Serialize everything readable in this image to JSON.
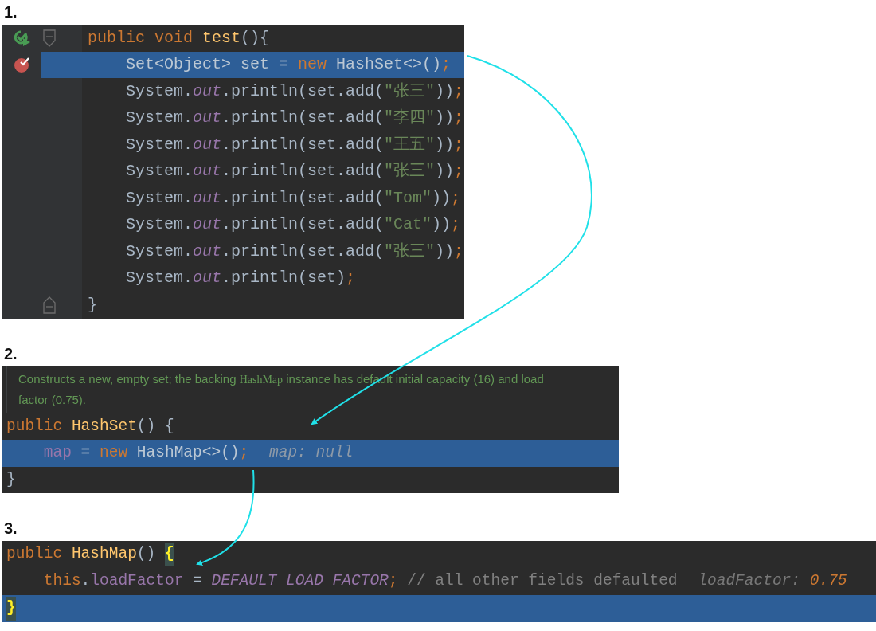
{
  "sections": [
    {
      "label": "1.",
      "kind": "editor",
      "lines": [
        {
          "selected": false,
          "run_marker": true,
          "fold_start": true,
          "tokens": [
            {
              "kind": "keyword",
              "text": "public void "
            },
            {
              "kind": "method",
              "text": "test"
            },
            {
              "kind": "plain",
              "text": "(){"
            }
          ],
          "children": [
            {
              "selected": true,
              "breakpoint": true,
              "tokens": [
                {
                  "kind": "plain",
                  "text": "Set<Object> set = "
                },
                {
                  "kind": "keyword",
                  "text": "new "
                },
                {
                  "kind": "plain",
                  "text": "HashSet<>()"
                },
                {
                  "kind": "keyword",
                  "text": ";"
                }
              ]
            },
            {
              "selected": false,
              "tokens": [
                {
                  "kind": "plain",
                  "text": "System."
                },
                {
                  "kind": "static_field",
                  "text": "out"
                },
                {
                  "kind": "plain",
                  "text": ".println(set.add("
                },
                {
                  "kind": "string",
                  "text": "\"张三\""
                },
                {
                  "kind": "plain",
                  "text": "))"
                },
                {
                  "kind": "keyword",
                  "text": ";"
                }
              ]
            },
            {
              "selected": false,
              "tokens": [
                {
                  "kind": "plain",
                  "text": "System."
                },
                {
                  "kind": "static_field",
                  "text": "out"
                },
                {
                  "kind": "plain",
                  "text": ".println(set.add("
                },
                {
                  "kind": "string",
                  "text": "\"李四\""
                },
                {
                  "kind": "plain",
                  "text": "))"
                },
                {
                  "kind": "keyword",
                  "text": ";"
                }
              ]
            },
            {
              "selected": false,
              "tokens": [
                {
                  "kind": "plain",
                  "text": "System."
                },
                {
                  "kind": "static_field",
                  "text": "out"
                },
                {
                  "kind": "plain",
                  "text": ".println(set.add("
                },
                {
                  "kind": "string",
                  "text": "\"王五\""
                },
                {
                  "kind": "plain",
                  "text": "))"
                },
                {
                  "kind": "keyword",
                  "text": ";"
                }
              ]
            },
            {
              "selected": false,
              "tokens": [
                {
                  "kind": "plain",
                  "text": "System."
                },
                {
                  "kind": "static_field",
                  "text": "out"
                },
                {
                  "kind": "plain",
                  "text": ".println(set.add("
                },
                {
                  "kind": "string",
                  "text": "\"张三\""
                },
                {
                  "kind": "plain",
                  "text": "))"
                },
                {
                  "kind": "keyword",
                  "text": ";"
                }
              ]
            },
            {
              "selected": false,
              "tokens": [
                {
                  "kind": "plain",
                  "text": "System."
                },
                {
                  "kind": "static_field",
                  "text": "out"
                },
                {
                  "kind": "plain",
                  "text": ".println(set.add("
                },
                {
                  "kind": "string",
                  "text": "\"Tom\""
                },
                {
                  "kind": "plain",
                  "text": "))"
                },
                {
                  "kind": "keyword",
                  "text": ";"
                }
              ]
            },
            {
              "selected": false,
              "tokens": [
                {
                  "kind": "plain",
                  "text": "System."
                },
                {
                  "kind": "static_field",
                  "text": "out"
                },
                {
                  "kind": "plain",
                  "text": ".println(set.add("
                },
                {
                  "kind": "string",
                  "text": "\"Cat\""
                },
                {
                  "kind": "plain",
                  "text": "))"
                },
                {
                  "kind": "keyword",
                  "text": ";"
                }
              ]
            },
            {
              "selected": false,
              "tokens": [
                {
                  "kind": "plain",
                  "text": "System."
                },
                {
                  "kind": "static_field",
                  "text": "out"
                },
                {
                  "kind": "plain",
                  "text": ".println(set.add("
                },
                {
                  "kind": "string",
                  "text": "\"张三\""
                },
                {
                  "kind": "plain",
                  "text": "))"
                },
                {
                  "kind": "keyword",
                  "text": ";"
                }
              ]
            },
            {
              "selected": false,
              "tokens": [
                {
                  "kind": "plain",
                  "text": "System."
                },
                {
                  "kind": "static_field",
                  "text": "out"
                },
                {
                  "kind": "plain",
                  "text": ".println(set)"
                },
                {
                  "kind": "keyword",
                  "text": ";"
                }
              ]
            }
          ]
        },
        {
          "selected": false,
          "fold_end": true,
          "tokens": [
            {
              "kind": "plain",
              "text": "}"
            }
          ]
        }
      ]
    },
    {
      "label": "2.",
      "kind": "snippet",
      "doc": [
        {
          "kind": "text",
          "text": "Constructs a new, empty set; the backing "
        },
        {
          "kind": "code",
          "text": "HashMap"
        },
        {
          "kind": "text",
          "text": " instance has default initial capacity (16) and load factor (0.75)."
        }
      ],
      "lines": [
        {
          "selected": false,
          "tokens": [
            {
              "kind": "keyword",
              "text": "public "
            },
            {
              "kind": "method",
              "text": "HashSet"
            },
            {
              "kind": "plain",
              "text": "() {"
            }
          ],
          "children": [
            {
              "selected": true,
              "tokens": [
                {
                  "kind": "field",
                  "text": "map"
                },
                {
                  "kind": "plain",
                  "text": " = "
                },
                {
                  "kind": "keyword",
                  "text": "new "
                },
                {
                  "kind": "plain",
                  "text": "HashMap<>()"
                },
                {
                  "kind": "keyword",
                  "text": ";"
                }
              ],
              "hint": [
                {
                  "kind": "label",
                  "text": "map: null"
                }
              ]
            }
          ]
        },
        {
          "selected": false,
          "tokens": [
            {
              "kind": "plain",
              "text": "}"
            }
          ]
        }
      ]
    },
    {
      "label": "3.",
      "kind": "snippet",
      "lines": [
        {
          "selected": false,
          "tokens": [
            {
              "kind": "keyword",
              "text": "public "
            },
            {
              "kind": "method",
              "text": "HashMap"
            },
            {
              "kind": "plain",
              "text": "() "
            },
            {
              "kind": "brace_match",
              "text": "{"
            }
          ],
          "children": [
            {
              "selected": false,
              "tokens": [
                {
                  "kind": "keyword",
                  "text": "this"
                },
                {
                  "kind": "plain",
                  "text": "."
                },
                {
                  "kind": "field",
                  "text": "loadFactor"
                },
                {
                  "kind": "plain",
                  "text": " = "
                },
                {
                  "kind": "constant",
                  "text": "DEFAULT_LOAD_FACTOR"
                },
                {
                  "kind": "keyword",
                  "text": ";"
                },
                {
                  "kind": "comment",
                  "text": " // all other fields defaulted"
                }
              ],
              "hint": [
                {
                  "kind": "label",
                  "text": "loadFactor: "
                },
                {
                  "kind": "value",
                  "text": "0.75"
                }
              ]
            }
          ]
        },
        {
          "selected": true,
          "tokens": [
            {
              "kind": "brace_match",
              "text": "}"
            }
          ]
        }
      ]
    }
  ]
}
